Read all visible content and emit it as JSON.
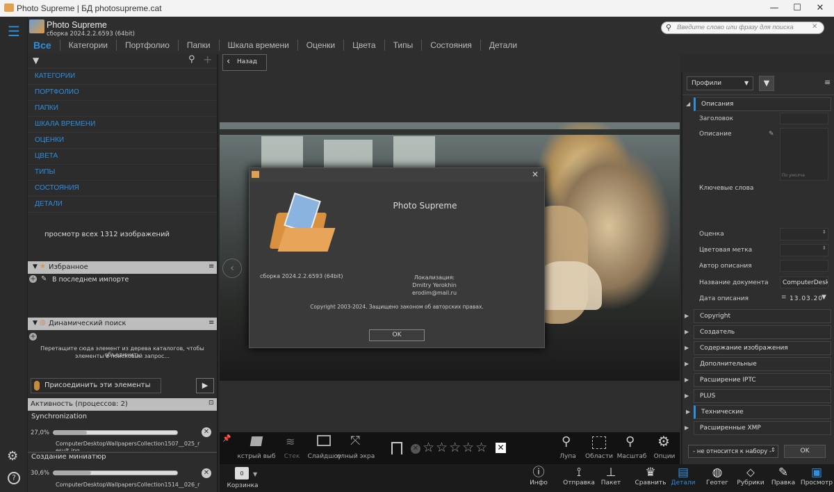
{
  "window": {
    "title": "Photo Supreme | БД photosupreme.cat",
    "minimize": "—",
    "maximize": "☐",
    "close": "✕"
  },
  "app": {
    "name": "Photo Supreme",
    "build": "сборка 2024.2.2.6593 (64bit)"
  },
  "tabs": [
    "Все",
    "Категории",
    "Портфолио",
    "Папки",
    "Шкала времени",
    "Оценки",
    "Цвета",
    "Типы",
    "Состояния",
    "Детали"
  ],
  "search": {
    "placeholder": "Введите слово или фразу для поиска"
  },
  "nav": {
    "back": "Назад"
  },
  "left": {
    "links": [
      "КАТЕГОРИИ",
      "ПОРТФОЛИО",
      "ПАПКИ",
      "ШКАЛА ВРЕМЕНИ",
      "ОЦЕНКИ",
      "ЦВЕТА",
      "ТИПЫ",
      "СОСТОЯНИЯ",
      "ДЕТАЛИ"
    ],
    "view_all": "просмотр всех 1312 изображений",
    "favorites": {
      "title": "Избранное",
      "item": "В последнем импорте"
    },
    "dynamic": {
      "title": "Динамический поиск",
      "hint1": "Перетащите сюда элемент из дерева каталогов, чтобы объединить",
      "hint2": "элементы в поисковый запрос...",
      "join": "Присоединить эти элементы"
    },
    "activity": {
      "title": "Активность (процессов: 2)",
      "p1": {
        "name": "Synchronization",
        "pct": "27,0%",
        "progress": 0.27,
        "file": "ComputerDesktopWallpapersCollection1507__025_r",
        "file2": "esult.jpg"
      },
      "p2": {
        "name": "Создание миниатюр",
        "pct": "30,6%",
        "progress": 0.306,
        "file": "ComputerDesktopWallpapersCollection1514__026_r"
      }
    }
  },
  "dialog": {
    "title": "Photo Supreme",
    "build": "сборка 2024.2.2.6593 (64bit)",
    "loc_label": "Локализация:",
    "loc_name": "Dmitry Yerokhin",
    "loc_email": "erodim@mail.ru",
    "copyright": "Copyright 2003-2024. Защищено законом об авторских правах.",
    "ok": "OK"
  },
  "toolbar": {
    "quick": "кстрый выб",
    "stack": "Стек",
    "slideshow": "Слайдшоу",
    "fullscreen": "олный экра",
    "loupe": "Лупа",
    "areas": "Области",
    "zoom": "Масштаб",
    "options": "Опции"
  },
  "bottom": {
    "basket_count": "0",
    "basket": "Корзинка",
    "info": "Инфо",
    "send": "Отправка",
    "batch": "Пакет",
    "compare": "Сравнить",
    "details": "Детали",
    "geotag": "Геотег",
    "rubrics": "Рубрики",
    "edit": "Правка",
    "view": "Просмотр"
  },
  "right": {
    "profiles": "Профили",
    "descriptions": "Описания",
    "fields": [
      "Заголовок",
      "Описание",
      "Ключевые слова",
      "Оценка",
      "Цветовая метка",
      "Автор описания",
      "Название документа",
      "Дата описания"
    ],
    "default_hint": "По умолча",
    "doc_name": "ComputerDeskto",
    "date": "13.03.20",
    "sections": [
      "Copyright",
      "Создатель",
      "Содержание изображения",
      "Дополнительные",
      "Расширение IPTC",
      "PLUS",
      "Технические",
      "Расширенные XMP"
    ],
    "set_select": "- не относится к набору -",
    "ok": "OK"
  }
}
